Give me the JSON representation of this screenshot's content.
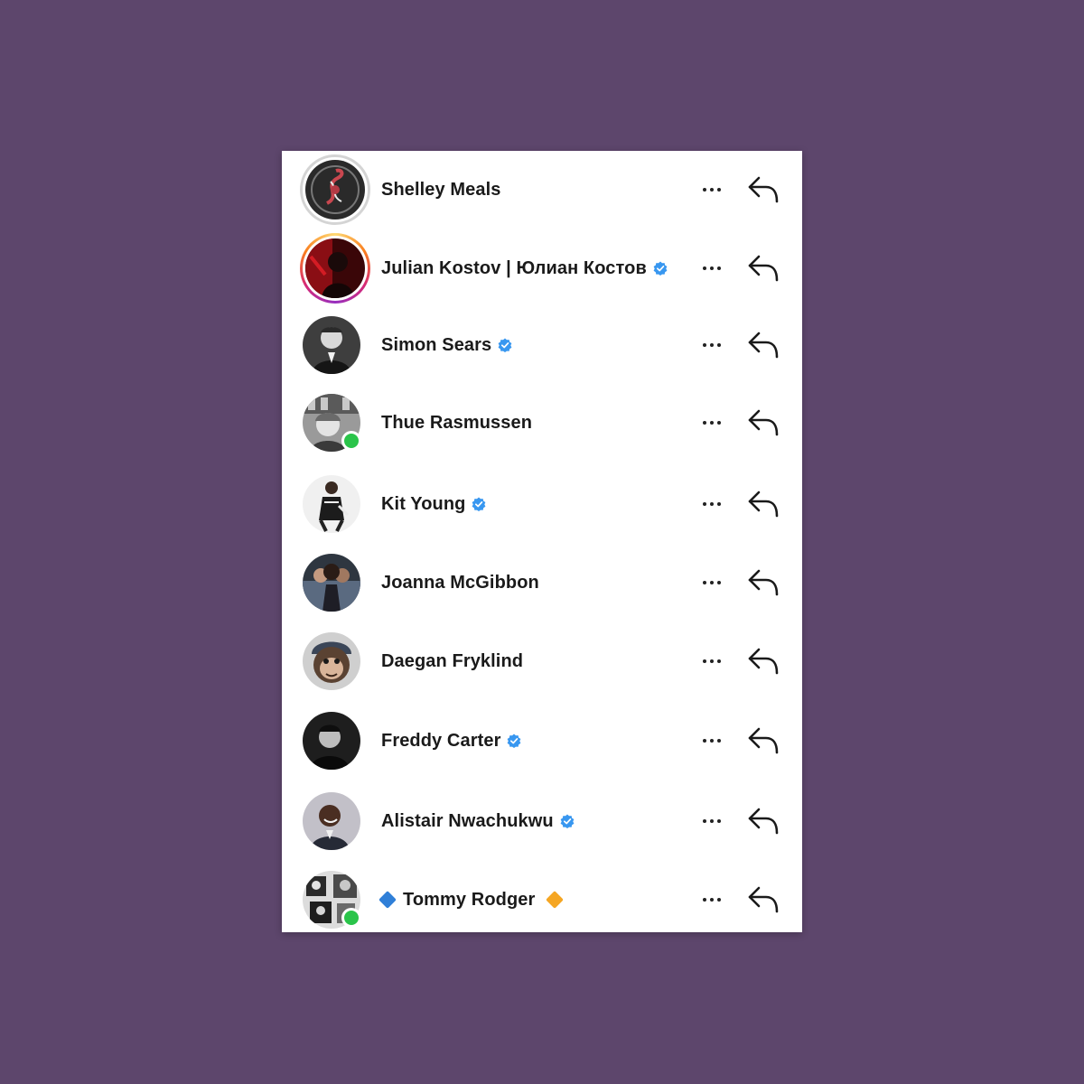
{
  "conversations": [
    {
      "name": "Shelley Meals",
      "verified": false,
      "online": false,
      "ring": "plain",
      "avatar": "tattoo-art-avatar"
    },
    {
      "name": "Julian Kostov | Юлиан Костов",
      "verified": true,
      "online": false,
      "ring": "story",
      "avatar": "red-portrait-avatar"
    },
    {
      "name": "Simon Sears",
      "verified": true,
      "online": false,
      "ring": "none",
      "avatar": "bw-portrait-avatar"
    },
    {
      "name": "Thue Rasmussen",
      "verified": false,
      "online": true,
      "ring": "none",
      "avatar": "bw-photo-avatar"
    },
    {
      "name": "Kit Young",
      "verified": true,
      "online": false,
      "ring": "none",
      "avatar": "fashion-photo-avatar"
    },
    {
      "name": "Joanna McGibbon",
      "verified": false,
      "online": false,
      "ring": "none",
      "avatar": "group-photo-avatar"
    },
    {
      "name": "Daegan Fryklind",
      "verified": false,
      "online": false,
      "ring": "none",
      "avatar": "monkey-mask-avatar"
    },
    {
      "name": "Freddy Carter",
      "verified": true,
      "online": false,
      "ring": "none",
      "avatar": "dark-portrait-avatar"
    },
    {
      "name": "Alistair Nwachukwu",
      "verified": true,
      "online": false,
      "ring": "none",
      "avatar": "smiling-portrait-avatar"
    },
    {
      "name": "Tommy Rodger",
      "verified": false,
      "online": true,
      "ring": "none",
      "avatar": "bw-collage-avatar",
      "prefix_emoji": "blue-diamond",
      "suffix_emoji": "orange-diamond"
    }
  ],
  "actions": {
    "more_icon": "more-options-icon",
    "reply_icon": "reply-arrow-icon"
  },
  "colors": {
    "background": "#5d466c",
    "verified_badge": "#3897f0",
    "online_dot": "#2ac44a",
    "blue_diamond": "#2f7fd8",
    "orange_diamond": "#f5a623"
  }
}
